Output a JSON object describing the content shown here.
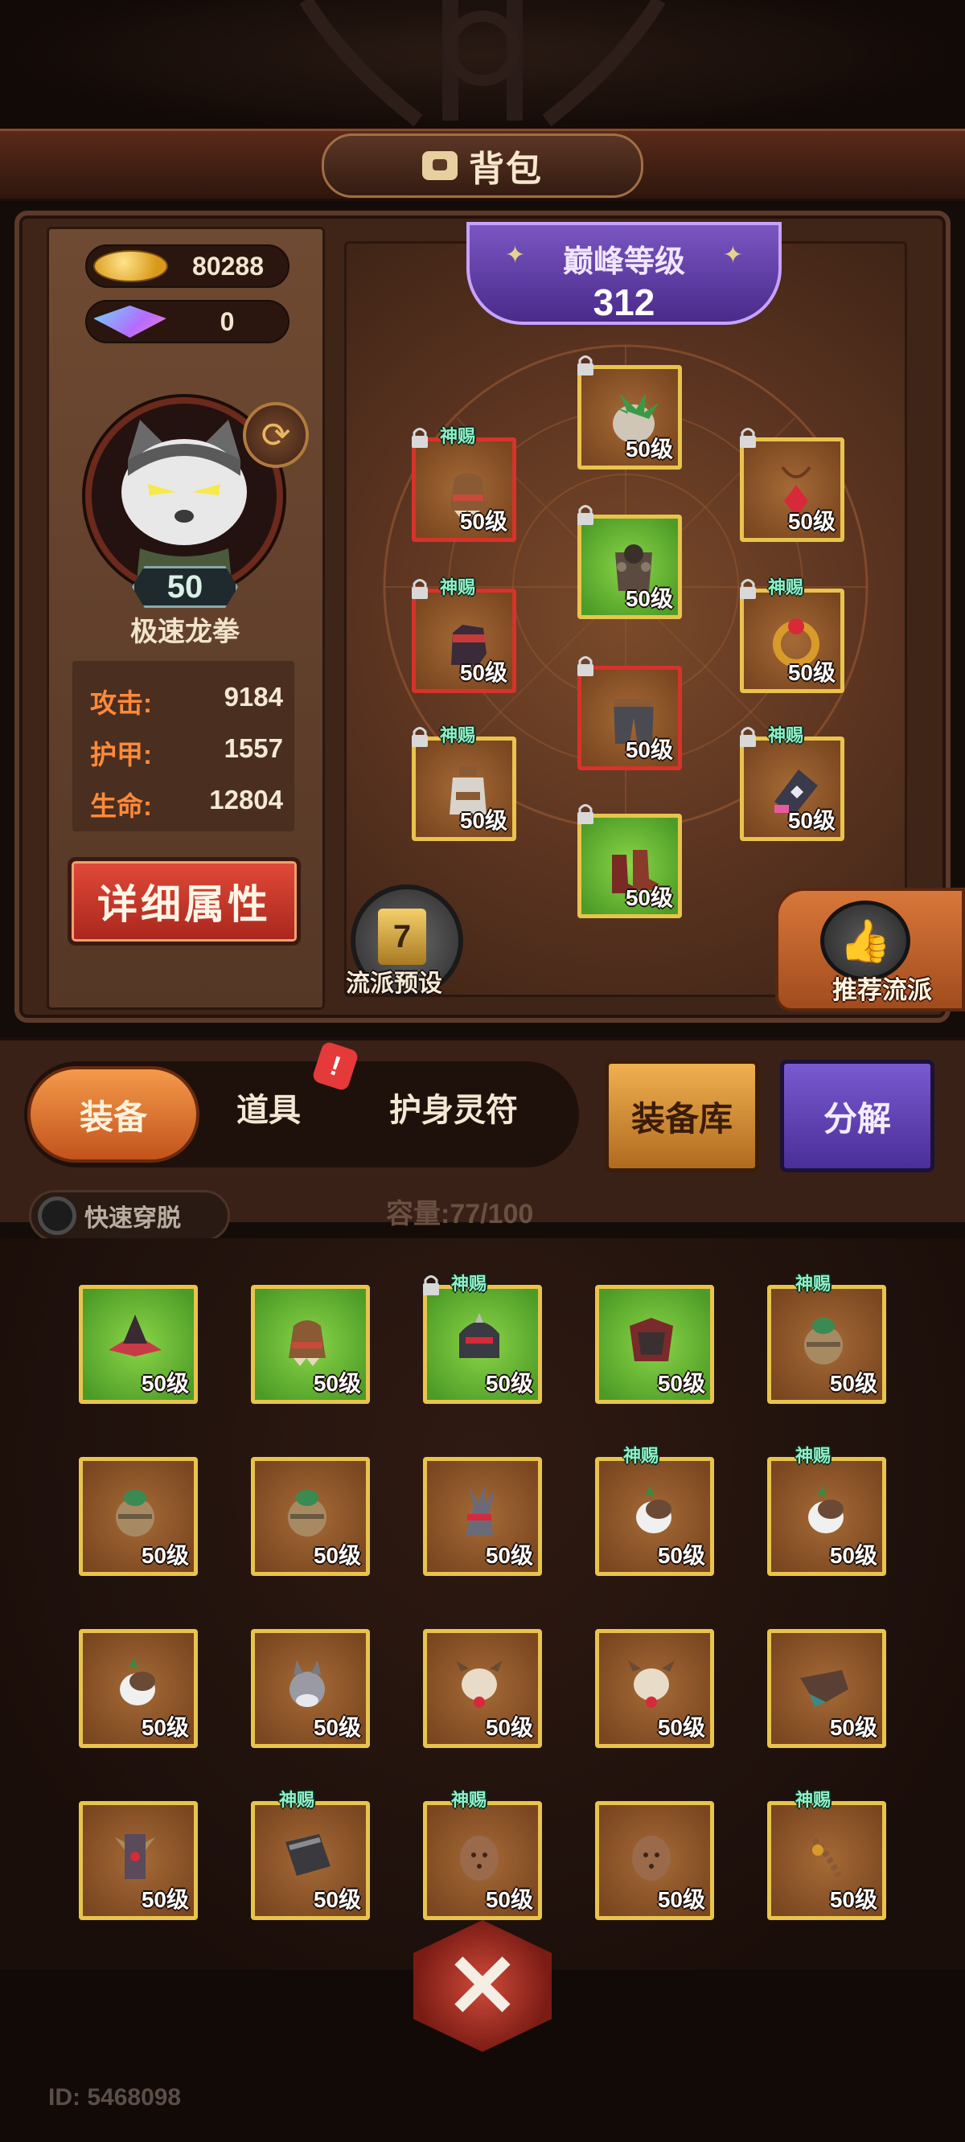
{
  "header": {
    "title": "背包"
  },
  "currencies": {
    "gold": "80288",
    "gems": "0"
  },
  "hero": {
    "level": "50",
    "name": "极速龙拳",
    "stats": [
      {
        "key": "攻击:",
        "value": "9184"
      },
      {
        "key": "护甲:",
        "value": "1557"
      },
      {
        "key": "生命:",
        "value": "12804"
      }
    ],
    "detail_button": "详细属性"
  },
  "peak": {
    "label": "巅峰等级",
    "value": "312"
  },
  "equipped_slots": [
    {
      "level": "50级",
      "tag": "",
      "locked": true,
      "quality": "gold",
      "item": "plant-head"
    },
    {
      "level": "50级",
      "tag": "神赐",
      "locked": true,
      "quality": "red",
      "item": "gauntlet"
    },
    {
      "level": "50级",
      "tag": "",
      "locked": true,
      "quality": "gold",
      "item": "amulet"
    },
    {
      "level": "50级",
      "tag": "",
      "locked": true,
      "quality": "green",
      "item": "chestplate"
    },
    {
      "level": "50级",
      "tag": "神赐",
      "locked": true,
      "quality": "red",
      "item": "glove"
    },
    {
      "level": "50级",
      "tag": "神赐",
      "locked": true,
      "quality": "gold",
      "item": "ring"
    },
    {
      "level": "50级",
      "tag": "",
      "locked": true,
      "quality": "red",
      "item": "pants"
    },
    {
      "level": "50级",
      "tag": "神赐",
      "locked": true,
      "quality": "gold",
      "item": "bottle"
    },
    {
      "level": "50级",
      "tag": "神赐",
      "locked": true,
      "quality": "gold",
      "item": "rune"
    },
    {
      "level": "50级",
      "tag": "",
      "locked": true,
      "quality": "green",
      "item": "boots"
    }
  ],
  "sect_preset": {
    "label": "流派预设",
    "icon_text": "7"
  },
  "recommend": {
    "label": "推荐流派"
  },
  "tabs": [
    {
      "label": "装备",
      "active": true
    },
    {
      "label": "道具",
      "active": false
    },
    {
      "label": "护身灵符",
      "active": false
    }
  ],
  "alert_badge": "!",
  "buttons": {
    "library": "装备库",
    "decompose": "分解"
  },
  "quick_dress": "快速穿脱",
  "capacity": "容量:77/100",
  "inventory": [
    {
      "level": "50级",
      "tag": "",
      "locked": false,
      "quality": "green",
      "item": "hat"
    },
    {
      "level": "50级",
      "tag": "",
      "locked": false,
      "quality": "green",
      "item": "gauntlet"
    },
    {
      "level": "50级",
      "tag": "神赐",
      "locked": true,
      "quality": "green",
      "item": "helmet"
    },
    {
      "level": "50级",
      "tag": "",
      "locked": false,
      "quality": "green",
      "item": "armor"
    },
    {
      "level": "50级",
      "tag": "神赐",
      "locked": false,
      "quality": "gold",
      "item": "pouch"
    },
    {
      "level": "50级",
      "tag": "",
      "locked": false,
      "quality": "gold",
      "item": "pouch"
    },
    {
      "level": "50级",
      "tag": "",
      "locked": false,
      "quality": "gold",
      "item": "pouch"
    },
    {
      "level": "50级",
      "tag": "",
      "locked": false,
      "quality": "gold",
      "item": "claw"
    },
    {
      "level": "50级",
      "tag": "神赐",
      "locked": false,
      "quality": "gold",
      "item": "beast"
    },
    {
      "level": "50级",
      "tag": "神赐",
      "locked": false,
      "quality": "gold",
      "item": "beast"
    },
    {
      "level": "50级",
      "tag": "",
      "locked": false,
      "quality": "gold",
      "item": "beast"
    },
    {
      "level": "50级",
      "tag": "",
      "locked": false,
      "quality": "gold",
      "item": "wolf"
    },
    {
      "level": "50级",
      "tag": "",
      "locked": false,
      "quality": "gold",
      "item": "skull"
    },
    {
      "level": "50级",
      "tag": "",
      "locked": false,
      "quality": "gold",
      "item": "skull"
    },
    {
      "level": "50级",
      "tag": "",
      "locked": false,
      "quality": "gold",
      "item": "bird"
    },
    {
      "level": "50级",
      "tag": "",
      "locked": false,
      "quality": "gold",
      "item": "totem"
    },
    {
      "level": "50级",
      "tag": "神赐",
      "locked": false,
      "quality": "gold",
      "item": "book"
    },
    {
      "level": "50级",
      "tag": "神赐",
      "locked": false,
      "quality": "gold",
      "item": "egg"
    },
    {
      "level": "50级",
      "tag": "",
      "locked": false,
      "quality": "gold",
      "item": "egg"
    },
    {
      "level": "50级",
      "tag": "神赐",
      "locked": false,
      "quality": "gold",
      "item": "beads"
    }
  ],
  "bottom_button_icon": "✕",
  "user_id": "ID: 5468098",
  "colors": {
    "green_slot": "#6bbd34",
    "gold_border": "#e1b84a",
    "red_border": "#d6332a",
    "tag_text": "#8ff0c6"
  }
}
